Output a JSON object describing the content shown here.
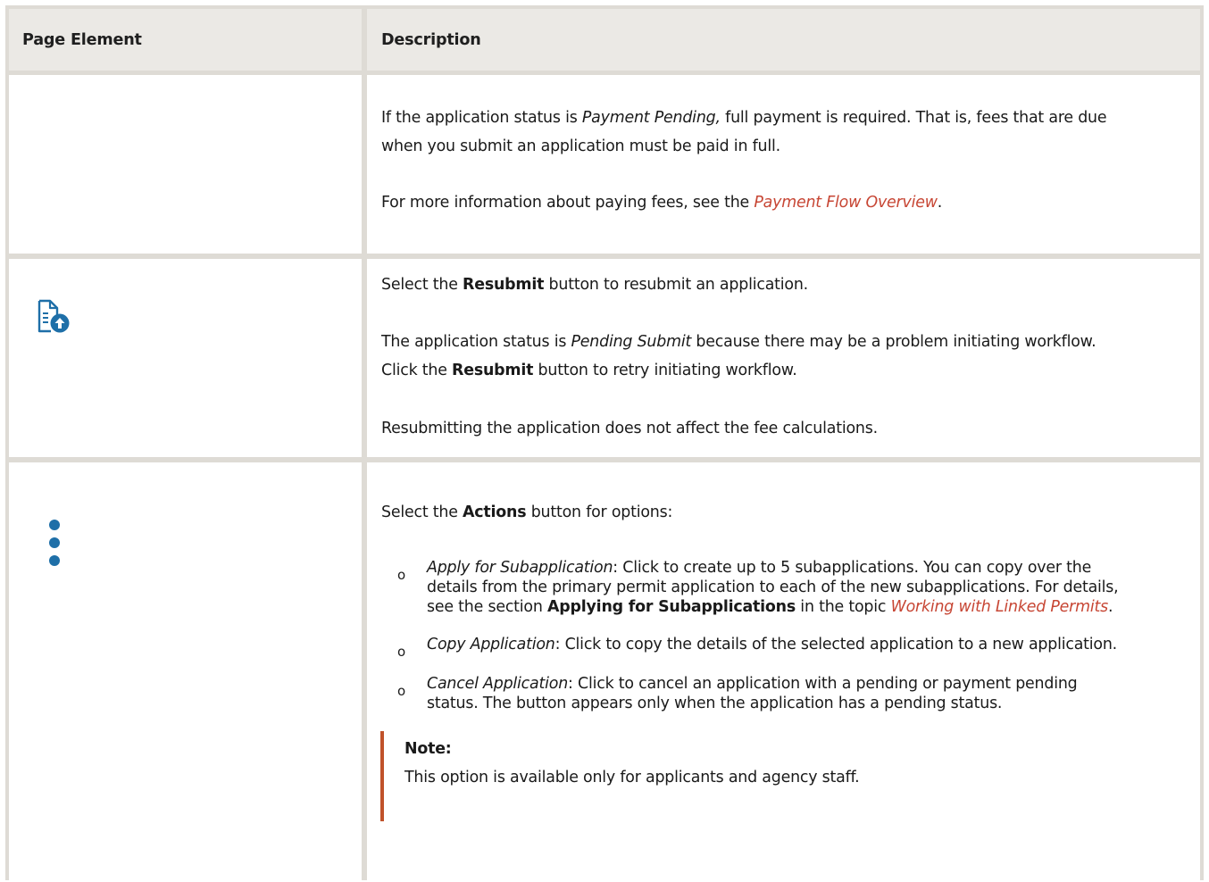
{
  "header": {
    "col1": "Page Element",
    "col2": "Description"
  },
  "row1": {
    "p1_a": "If the application status is ",
    "p1_em": "Payment Pending,",
    "p1_b": " full payment is required. That is, fees that are due",
    "p1_c": "when you submit an application must be paid in full.",
    "p2_a": "For more information about paying fees, see the ",
    "p2_link": "Payment Flow Overview",
    "p2_b": "."
  },
  "row2": {
    "icon": "document-upload-icon",
    "p1_a": "Select the ",
    "p1_b": "Resubmit",
    "p1_c": " button to resubmit an application.",
    "p2_a": "The application status is ",
    "p2_em": "Pending Submit",
    "p2_b": " because there may be a problem initiating workflow.",
    "p2_c": "Click the ",
    "p2_d": "Resubmit",
    "p2_e": " button to retry initiating workflow.",
    "p3": "Resubmitting the application does not affect the fee calculations."
  },
  "row3": {
    "icon": "more-vertical-icon",
    "intro_a": "Select the ",
    "intro_b": "Actions",
    "intro_c": " button for options:",
    "bullet_glyph": "o",
    "items": [
      {
        "em": "Apply for Subapplication",
        "l1": ": Click to create up to 5 subapplications. You can copy over the",
        "l2": "details from the primary permit application to each of the new subapplications. For details,",
        "l3_a": " see the section ",
        "l3_b": "Applying for Subapplications",
        "l3_c": " in the topic ",
        "l3_link": "Working with Linked Permits",
        "l3_d": "."
      },
      {
        "em": "Copy Application",
        "l1": ": Click to copy the details of the selected application to a new application."
      },
      {
        "em": "Cancel Application",
        "l1": ": Click to cancel an application with a pending or payment pending",
        "l2": "status. The button appears only when the application has a pending status."
      }
    ],
    "note_title": "Note:",
    "note_text": "This option is available only for applicants and agency staff."
  },
  "colors": {
    "link": "#c74634",
    "icon": "#1e6fa8",
    "note_bar": "#c0522a",
    "header_bg": "#ebe9e5",
    "grid": "#dedbd5"
  }
}
